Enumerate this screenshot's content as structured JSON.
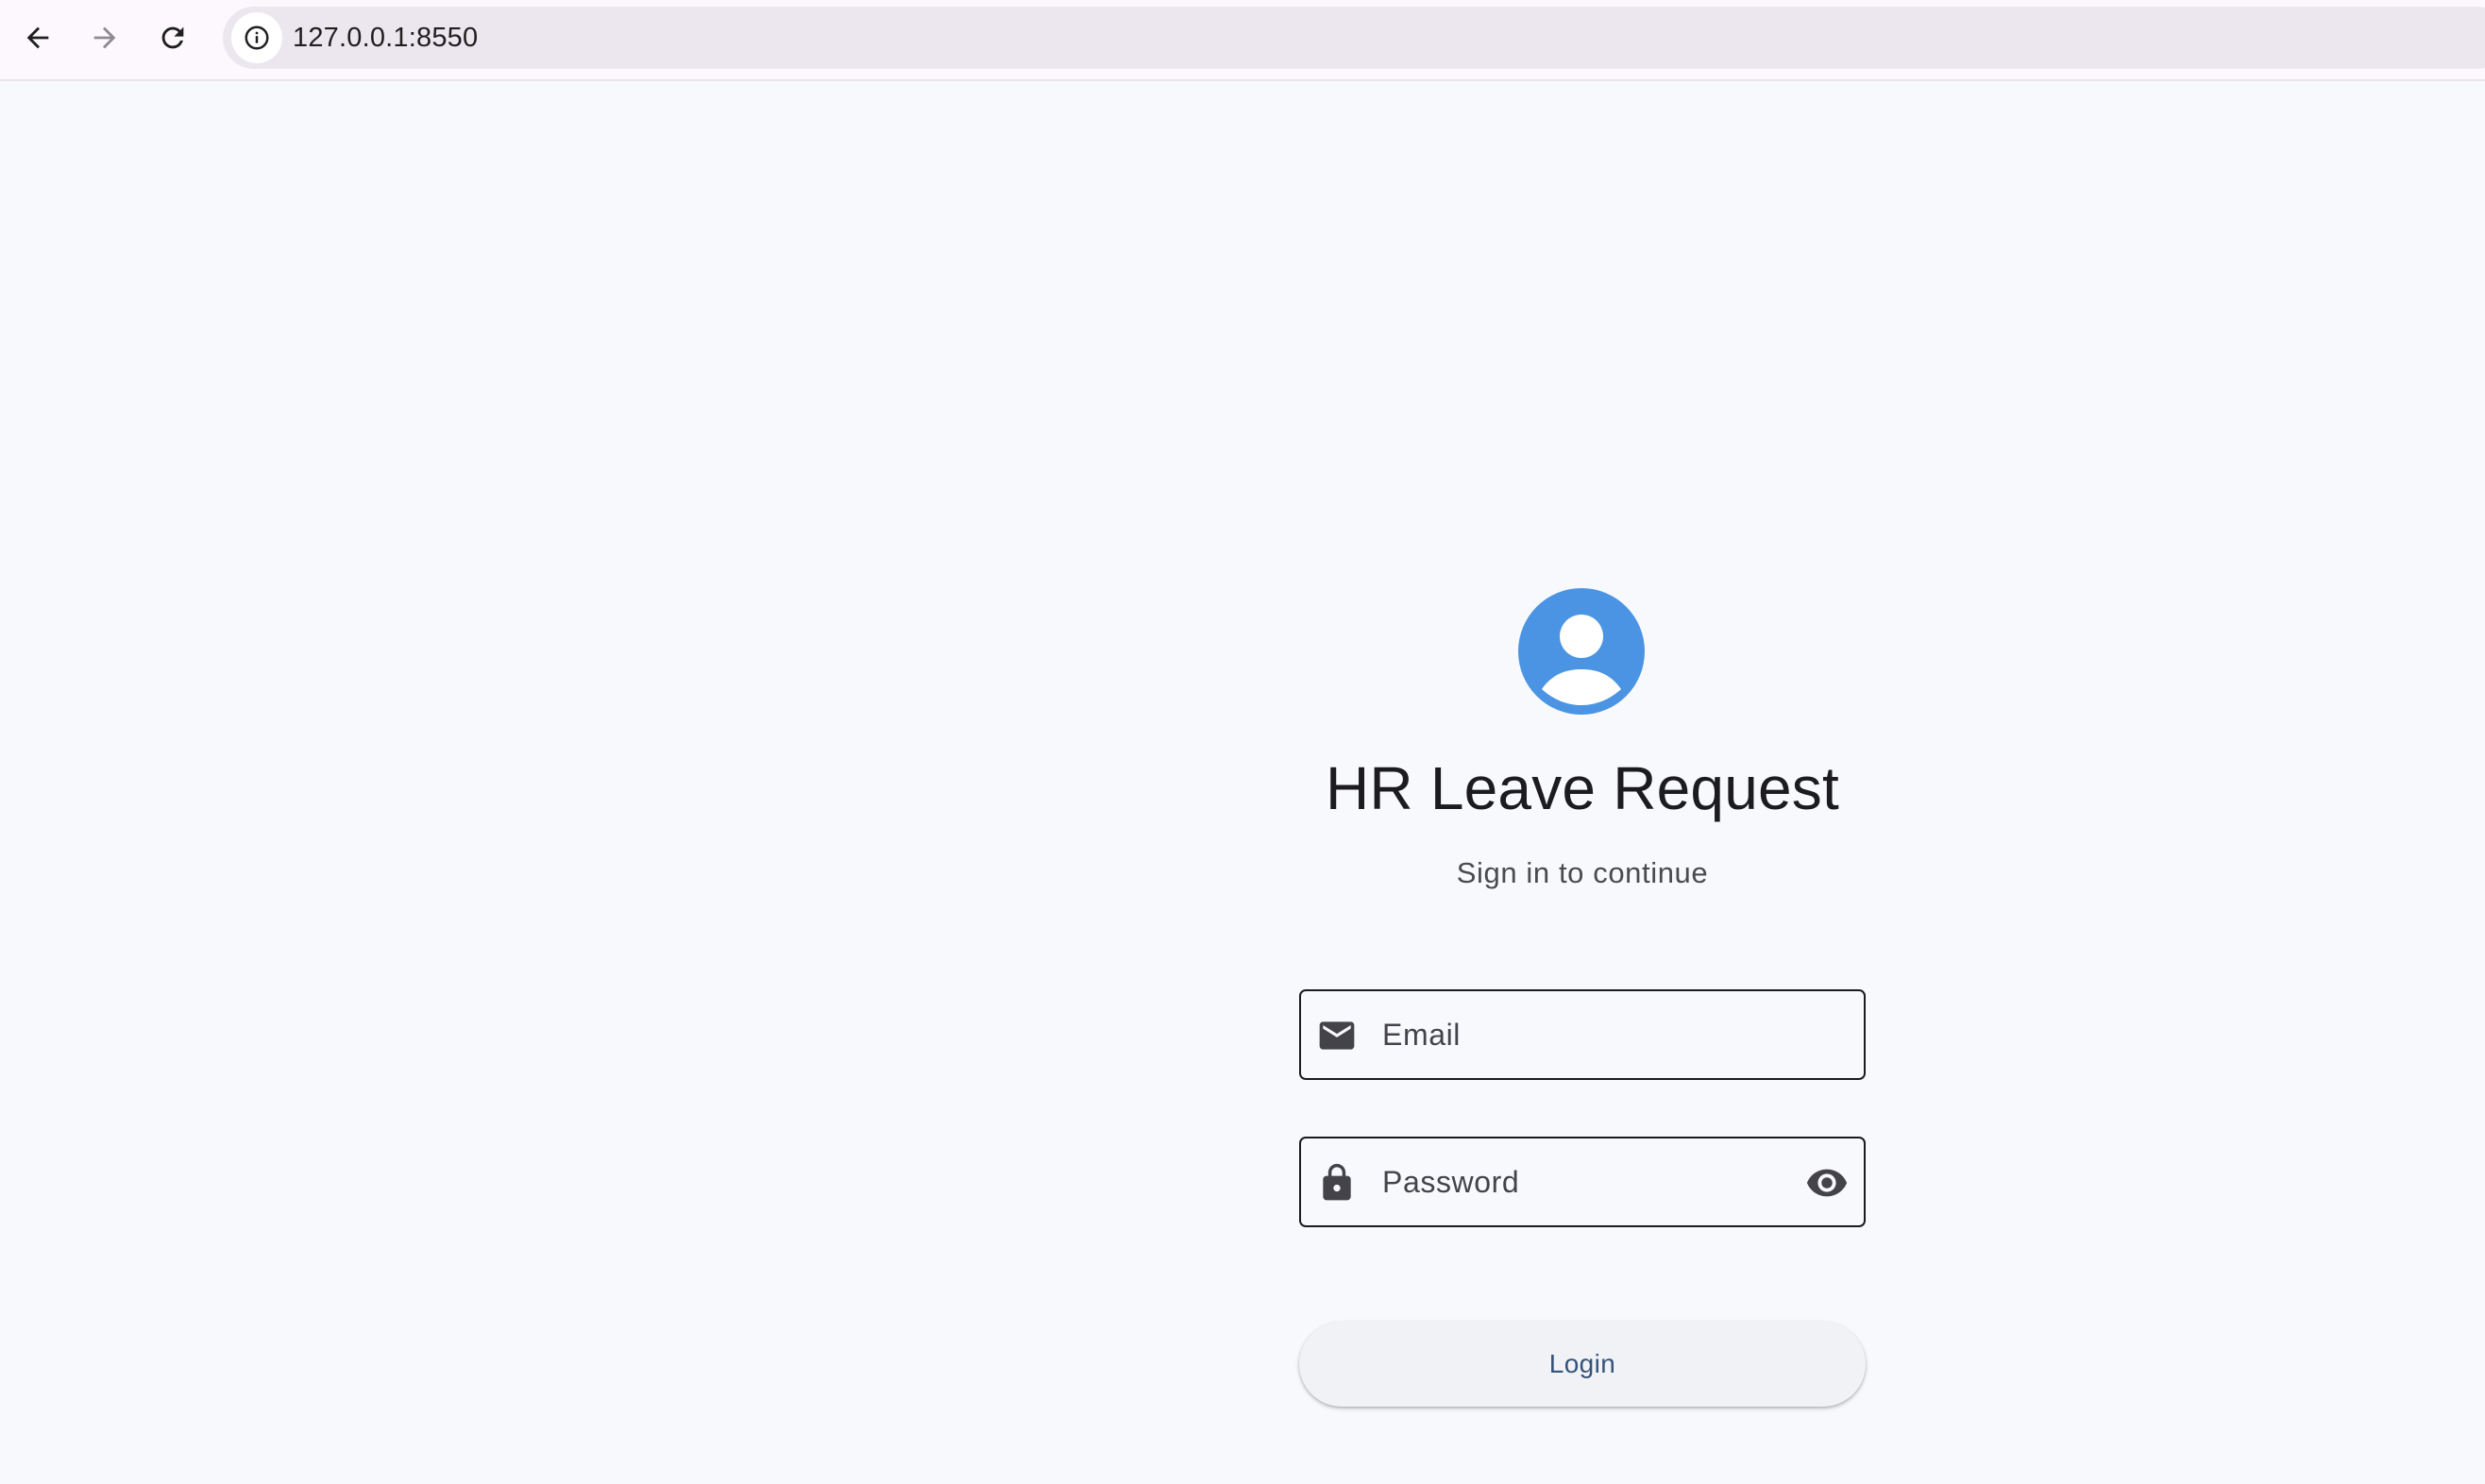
{
  "browser": {
    "url": "127.0.0.1:8550",
    "icons": {
      "back": "arrow-left-icon",
      "forward": "arrow-right-icon",
      "reload": "reload-icon",
      "site_info": "info-icon"
    }
  },
  "login": {
    "title": "HR Leave Request",
    "subtitle": "Sign in to continue",
    "avatar_icon": "account-circle-icon",
    "email": {
      "placeholder": "Email",
      "value": "",
      "icon": "mail-icon"
    },
    "password": {
      "placeholder": "Password",
      "value": "",
      "icon": "lock-icon",
      "toggle_icon": "eye-icon"
    },
    "login_button": "Login"
  },
  "colors": {
    "page_background": "#f8f9fd",
    "avatar_accent": "#4a94e3",
    "title_text": "#1c1b1f",
    "button_text": "#34537a",
    "button_background": "#f1f2f6",
    "field_border": "#1c1b1f"
  }
}
